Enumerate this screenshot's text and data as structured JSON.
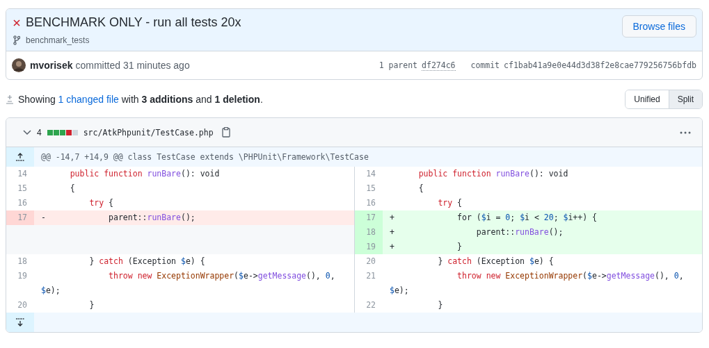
{
  "commit": {
    "ci_failed": true,
    "title": "BENCHMARK ONLY - run all tests 20x",
    "branch": "benchmark_tests",
    "browse_button": "Browse files",
    "author": "mvorisek",
    "action": "committed 31 minutes ago",
    "parent_label": "1 parent",
    "parent_sha": "df274c6",
    "commit_label": "commit",
    "commit_sha": "cf1bab41a9e0e44d3d38f2e8cae779256756bfdb"
  },
  "summary": {
    "lead": "Showing",
    "link": "1 changed file",
    "rest": "with **3 additions** and **1 deletion**."
  },
  "view_toggle": [
    {
      "label": "Unified",
      "selected": false
    },
    {
      "label": "Split",
      "selected": true
    }
  ],
  "file": {
    "expanded": true,
    "changes": "4",
    "diffstat": [
      {
        "kind": "add"
      },
      {
        "kind": "add"
      },
      {
        "kind": "add"
      },
      {
        "kind": "del"
      },
      {
        "kind": "neutral"
      }
    ],
    "path": "src/AtkPhpunit/TestCase.php",
    "hunk": "@@ -14,7 +14,9 @@ class TestCase extends \\PHPUnit\\Framework\\TestCase",
    "rows": [
      {
        "left": {
          "kind": "context",
          "number": "14",
          "tokens": [
            {
              "kind": "keyword",
              "text": "    public"
            },
            {
              "kind": "keyword",
              "text": " function"
            },
            {
              "kind": "function",
              "text": " runBare"
            },
            {
              "kind": "text",
              "text": "(): void"
            }
          ]
        },
        "right": {
          "kind": "context",
          "number": "14",
          "tokens": [
            {
              "kind": "keyword",
              "text": "    public"
            },
            {
              "kind": "keyword",
              "text": " function"
            },
            {
              "kind": "function",
              "text": " runBare"
            },
            {
              "kind": "text",
              "text": "(): void"
            }
          ]
        }
      },
      {
        "left": {
          "kind": "context",
          "number": "15",
          "tokens": [
            {
              "kind": "text",
              "text": "    {"
            }
          ]
        },
        "right": {
          "kind": "context",
          "number": "15",
          "tokens": [
            {
              "kind": "text",
              "text": "    {"
            }
          ]
        }
      },
      {
        "left": {
          "kind": "context",
          "number": "16",
          "tokens": [
            {
              "kind": "keyword",
              "text": "        try"
            },
            {
              "kind": "text",
              "text": " {"
            }
          ]
        },
        "right": {
          "kind": "context",
          "number": "16",
          "tokens": [
            {
              "kind": "keyword",
              "text": "        try"
            },
            {
              "kind": "text",
              "text": " {"
            }
          ]
        }
      },
      {
        "left": {
          "kind": "deletion",
          "number": "17",
          "marker": "-",
          "tokens": [
            {
              "kind": "text",
              "text": "            parent::"
            },
            {
              "kind": "function",
              "text": "runBare"
            },
            {
              "kind": "text",
              "text": "();"
            }
          ]
        },
        "right": {
          "kind": "addition",
          "number": "17",
          "marker": "+",
          "tokens": [
            {
              "kind": "text",
              "text": "            for ("
            },
            {
              "kind": "variable",
              "text": "$"
            },
            {
              "kind": "text",
              "text": "i = "
            },
            {
              "kind": "number",
              "text": "0"
            },
            {
              "kind": "text",
              "text": "; "
            },
            {
              "kind": "variable",
              "text": "$"
            },
            {
              "kind": "text",
              "text": "i < "
            },
            {
              "kind": "number",
              "text": "20"
            },
            {
              "kind": "text",
              "text": "; "
            },
            {
              "kind": "variable",
              "text": "$"
            },
            {
              "kind": "text",
              "text": "i++) {"
            }
          ]
        }
      },
      {
        "left": {
          "kind": "empty"
        },
        "right": {
          "kind": "addition",
          "number": "18",
          "marker": "+",
          "tokens": [
            {
              "kind": "text",
              "text": "                parent::"
            },
            {
              "kind": "function",
              "text": "runBare"
            },
            {
              "kind": "text",
              "text": "();"
            }
          ]
        }
      },
      {
        "left": {
          "kind": "empty"
        },
        "right": {
          "kind": "addition",
          "number": "19",
          "marker": "+",
          "tokens": [
            {
              "kind": "text",
              "text": "            }"
            }
          ]
        }
      },
      {
        "left": {
          "kind": "context",
          "number": "18",
          "tokens": [
            {
              "kind": "text",
              "text": "        } "
            },
            {
              "kind": "keyword",
              "text": "catch"
            },
            {
              "kind": "text",
              "text": " (Exception "
            },
            {
              "kind": "variable",
              "text": "$"
            },
            {
              "kind": "text",
              "text": "e) {"
            }
          ]
        },
        "right": {
          "kind": "context",
          "number": "20",
          "tokens": [
            {
              "kind": "text",
              "text": "        } "
            },
            {
              "kind": "keyword",
              "text": "catch"
            },
            {
              "kind": "text",
              "text": " (Exception "
            },
            {
              "kind": "variable",
              "text": "$"
            },
            {
              "kind": "text",
              "text": "e) {"
            }
          ]
        }
      },
      {
        "left": {
          "kind": "context",
          "number": "19",
          "tokens": [
            {
              "kind": "keyword",
              "text": "            throw"
            },
            {
              "kind": "keyword",
              "text": " new"
            },
            {
              "kind": "class",
              "text": " ExceptionWrapper"
            },
            {
              "kind": "text",
              "text": "("
            },
            {
              "kind": "variable",
              "text": "$"
            },
            {
              "kind": "text",
              "text": "e->"
            },
            {
              "kind": "function",
              "text": "getMessage"
            },
            {
              "kind": "text",
              "text": "(), "
            },
            {
              "kind": "number",
              "text": "0"
            },
            {
              "kind": "text",
              "text": ", "
            },
            {
              "kind": "variable",
              "text": "$"
            },
            {
              "kind": "text",
              "text": "e);"
            }
          ]
        },
        "right": {
          "kind": "context",
          "number": "21",
          "tokens": [
            {
              "kind": "keyword",
              "text": "            throw"
            },
            {
              "kind": "keyword",
              "text": " new"
            },
            {
              "kind": "class",
              "text": " ExceptionWrapper"
            },
            {
              "kind": "text",
              "text": "("
            },
            {
              "kind": "variable",
              "text": "$"
            },
            {
              "kind": "text",
              "text": "e->"
            },
            {
              "kind": "function",
              "text": "getMessage"
            },
            {
              "kind": "text",
              "text": "(), "
            },
            {
              "kind": "number",
              "text": "0"
            },
            {
              "kind": "text",
              "text": ", "
            },
            {
              "kind": "variable",
              "text": "$"
            },
            {
              "kind": "text",
              "text": "e);"
            }
          ]
        }
      },
      {
        "left": {
          "kind": "context",
          "number": "20",
          "tokens": [
            {
              "kind": "text",
              "text": "        }"
            }
          ]
        },
        "right": {
          "kind": "context",
          "number": "22",
          "tokens": [
            {
              "kind": "text",
              "text": "        }"
            }
          ]
        }
      }
    ]
  }
}
